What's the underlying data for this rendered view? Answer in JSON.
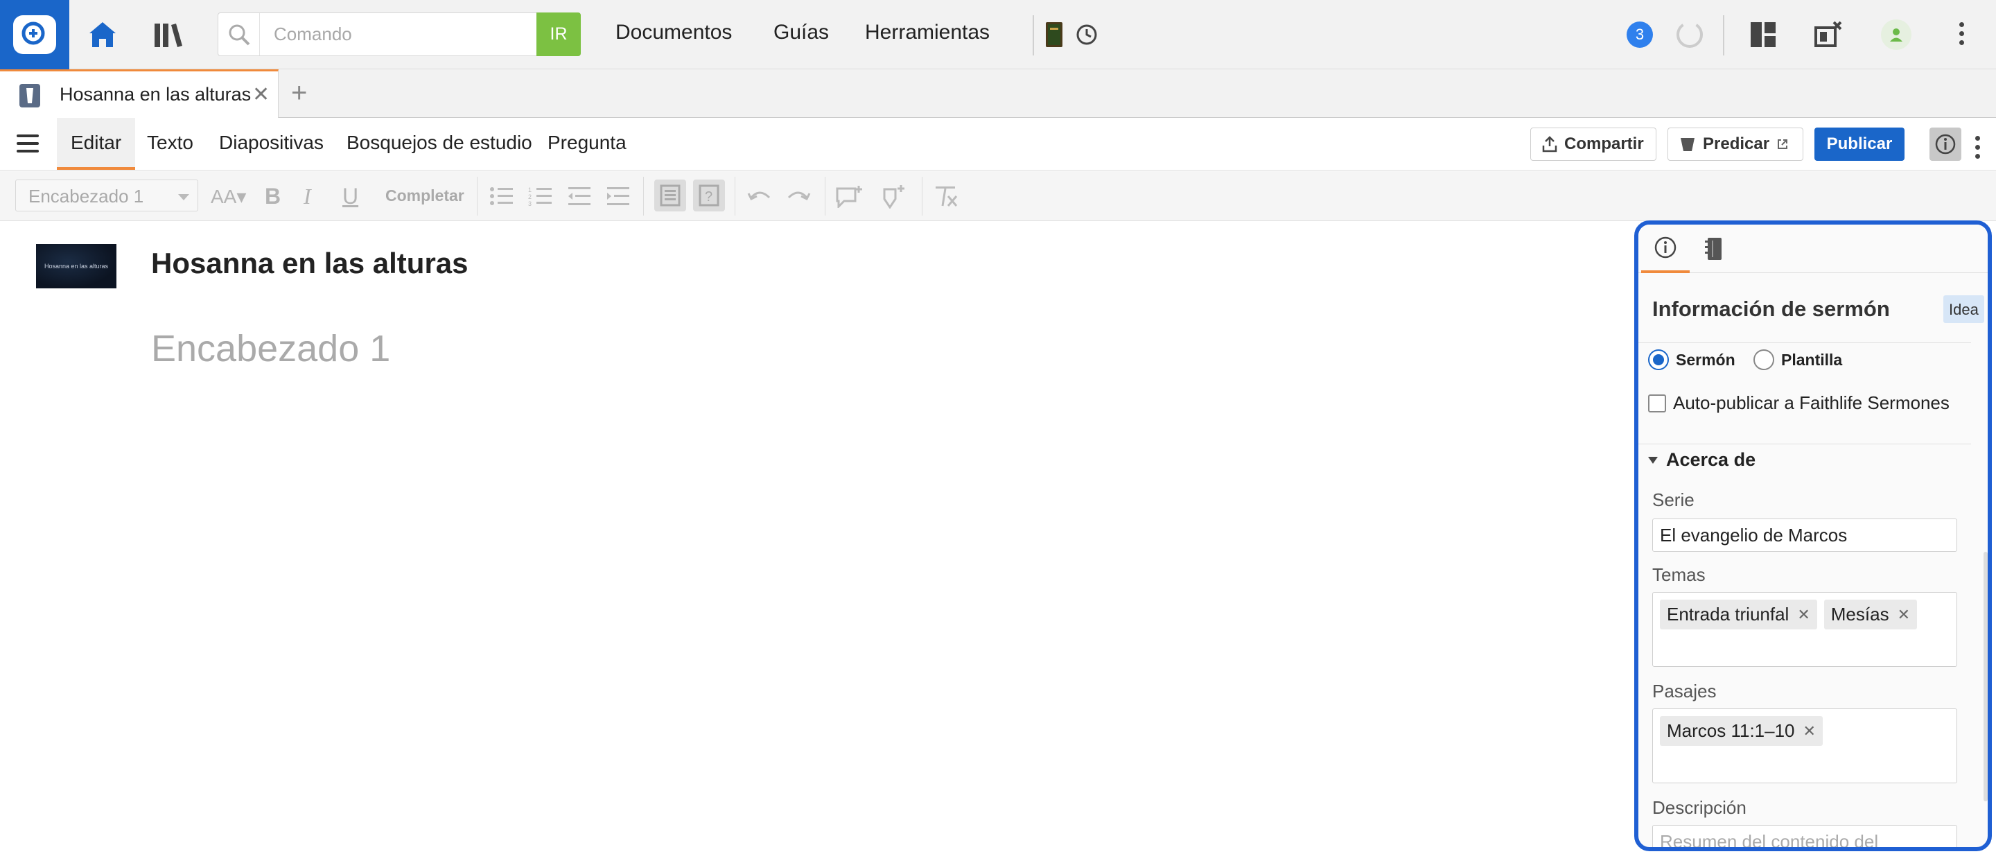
{
  "topbar": {
    "search_placeholder": "Comando",
    "go_label": "IR",
    "menu": [
      "Documentos",
      "Guías",
      "Herramientas"
    ],
    "notification_count": "3"
  },
  "tabs": {
    "active_doc_title": "Hosanna en las alturas"
  },
  "menubar": {
    "items": [
      "Editar",
      "Texto",
      "Diapositivas",
      "Bosquejos de estudio",
      "Pregunta"
    ],
    "share_label": "Compartir",
    "preach_label": "Predicar",
    "publish_label": "Publicar"
  },
  "toolbar": {
    "style_value": "Encabezado 1",
    "complete_label": "Completar"
  },
  "document": {
    "thumbnail_text": "Hosanna en las alturas",
    "title": "Hosanna en las alturas",
    "heading_placeholder": "Encabezado 1"
  },
  "panel": {
    "title": "Información de sermón",
    "badge": "Idea",
    "type_options": [
      "Sermón",
      "Plantilla"
    ],
    "selected_type": "Sermón",
    "autopublish_label": "Auto-publicar a Faithlife Sermones",
    "autopublish_checked": false,
    "section_title": "Acerca de",
    "serie_label": "Serie",
    "serie_value": "El evangelio de Marcos",
    "temas_label": "Temas",
    "temas": [
      "Entrada triunfal",
      "Mesías"
    ],
    "pasajes_label": "Pasajes",
    "pasajes": [
      "Marcos 11:1–10"
    ],
    "descripcion_label": "Descripción",
    "descripcion_placeholder": "Resumen del contenido del"
  },
  "colors": {
    "accent_blue": "#1a66c9",
    "accent_orange": "#f08a3c",
    "go_green": "#7cc142",
    "highlight_border": "#1f5fd3"
  }
}
